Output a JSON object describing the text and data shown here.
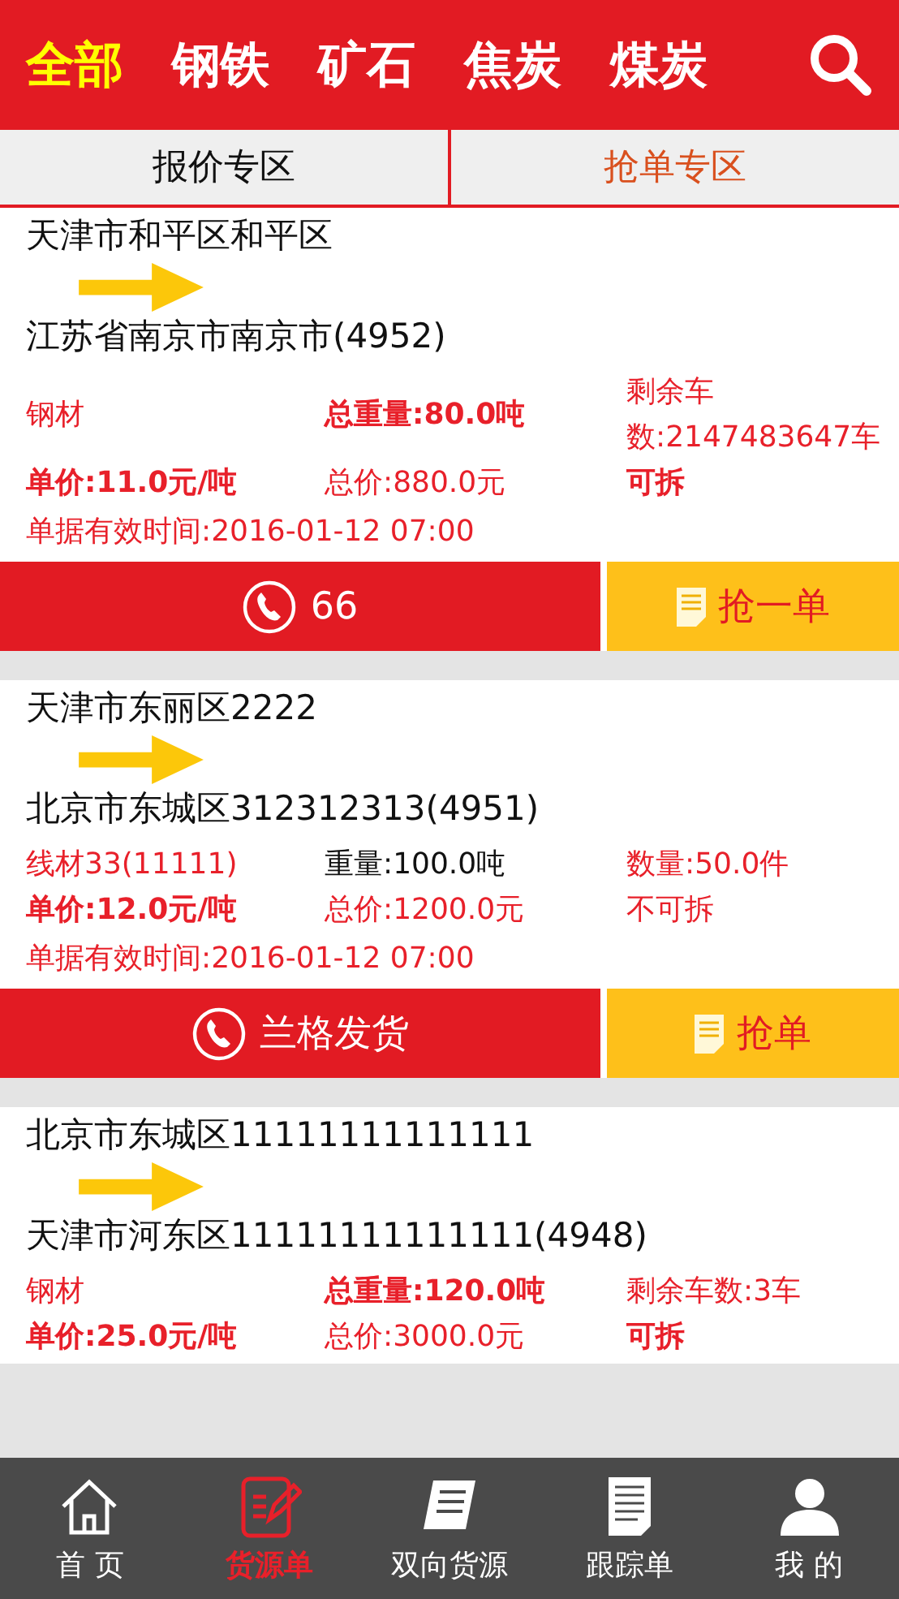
{
  "categories": [
    {
      "label": "全部",
      "selected": true
    },
    {
      "label": "钢铁",
      "selected": false
    },
    {
      "label": "矿石",
      "selected": false
    },
    {
      "label": "焦炭",
      "selected": false
    },
    {
      "label": "煤炭",
      "selected": false
    }
  ],
  "zones": [
    {
      "label": "报价专区",
      "selected": false
    },
    {
      "label": "抢单专区",
      "selected": true
    }
  ],
  "orders": [
    {
      "from": "天津市和平区和平区",
      "to": "江苏省南京市南京市(4952)",
      "cells": [
        {
          "text": "钢材",
          "color": "#e8202a",
          "bold": false
        },
        {
          "text": "总重量:80.0吨",
          "color": "#e8202a",
          "bold": true
        },
        {
          "text": "剩余车数:2147483647车",
          "color": "#e8202a",
          "bold": false
        },
        {
          "text": "单价:11.0元/吨",
          "color": "#e8202a",
          "bold": true
        },
        {
          "text": "总价:880.0元",
          "color": "#e8202a",
          "bold": false
        },
        {
          "text": "可拆",
          "color": "#e8202a",
          "bold": true
        }
      ],
      "expiry": "单据有效时间:2016-01-12 07:00",
      "contact": "66",
      "grab": "抢一单"
    },
    {
      "from": "天津市东丽区2222",
      "to": "北京市东城区312312313(4951)",
      "cells": [
        {
          "text": "线材33(11111)",
          "color": "#e8202a",
          "bold": false
        },
        {
          "text": "重量:100.0吨",
          "color": "#111111",
          "bold": false
        },
        {
          "text": "数量:50.0件",
          "color": "#e8202a",
          "bold": false
        },
        {
          "text": "单价:12.0元/吨",
          "color": "#e8202a",
          "bold": true
        },
        {
          "text": "总价:1200.0元",
          "color": "#e8202a",
          "bold": false
        },
        {
          "text": "不可拆",
          "color": "#e8202a",
          "bold": false
        }
      ],
      "expiry": "单据有效时间:2016-01-12 07:00",
      "contact": "兰格发货",
      "grab": "抢单"
    },
    {
      "from": "北京市东城区11111111111111",
      "to": "天津市河东区11111111111111(4948)",
      "cells": [
        {
          "text": "钢材",
          "color": "#e8202a",
          "bold": false
        },
        {
          "text": "总重量:120.0吨",
          "color": "#e8202a",
          "bold": true
        },
        {
          "text": "剩余车数:3车",
          "color": "#e8202a",
          "bold": false
        },
        {
          "text": "单价:25.0元/吨",
          "color": "#e8202a",
          "bold": true
        },
        {
          "text": "总价:3000.0元",
          "color": "#e8202a",
          "bold": false
        },
        {
          "text": "可拆",
          "color": "#e8202a",
          "bold": true
        }
      ]
    }
  ],
  "nav": [
    {
      "label": "首 页",
      "kind": "home",
      "selected": false
    },
    {
      "label": "货源单",
      "kind": "edit",
      "selected": true
    },
    {
      "label": "双向货源",
      "kind": "scroll",
      "selected": false
    },
    {
      "label": "跟踪单",
      "kind": "document",
      "selected": false
    },
    {
      "label": "我 的",
      "kind": "user",
      "selected": false
    }
  ]
}
